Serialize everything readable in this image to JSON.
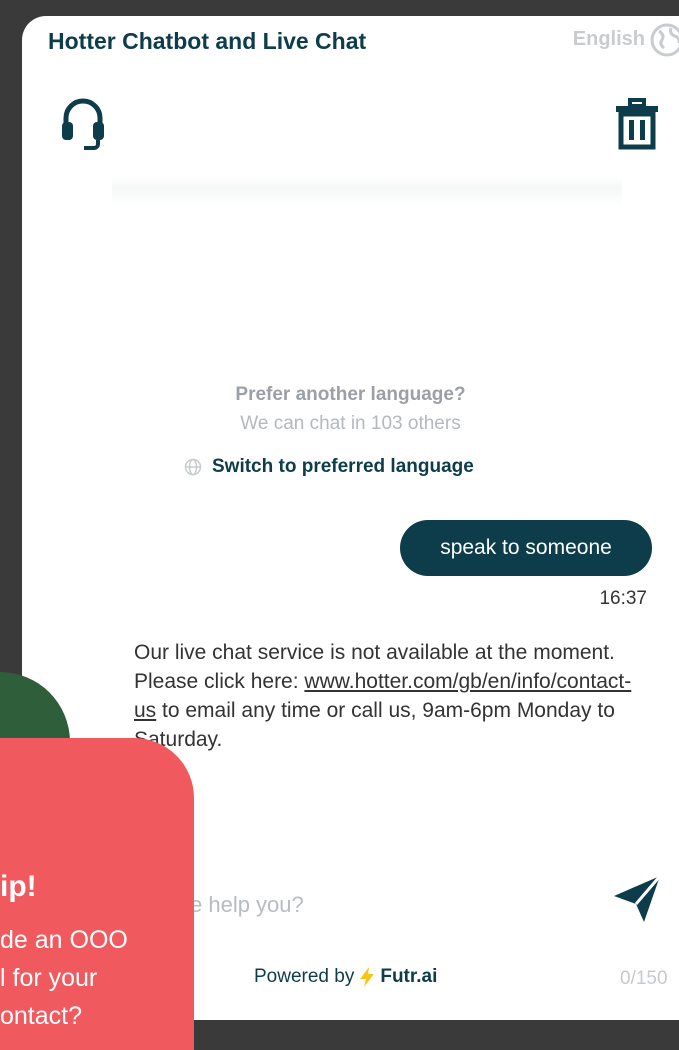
{
  "header": {
    "title": "Hotter Chatbot and Live Chat",
    "language": "English"
  },
  "language_prompt": {
    "title": "Prefer another language?",
    "subtitle": "We can chat in 103 others",
    "switch_label": "Switch to preferred language"
  },
  "messages": {
    "user_text": "speak to someone",
    "time": "16:37",
    "bot_text_before_link": "Our live chat service is not available at the moment. Please click here: ",
    "bot_link": "www.hotter.com/gb/en/info/contact-us",
    "bot_text_after_link": " to email any time or call us, 9am-6pm Monday to Saturday."
  },
  "composer": {
    "placeholder_visible": "e help you?",
    "char_count": "0/150"
  },
  "footer": {
    "powered_by": "Powered by",
    "brand": "Futr.ai"
  },
  "tip_card": {
    "title": "ip!",
    "line1": "de an OOO",
    "line2": "l for your",
    "line3": "ontact?"
  },
  "colors": {
    "brand_dark": "#0d3d4a",
    "tip_red": "#f05a5f",
    "accent_green": "#2e5e3a",
    "bolt_yellow": "#f5c518"
  }
}
